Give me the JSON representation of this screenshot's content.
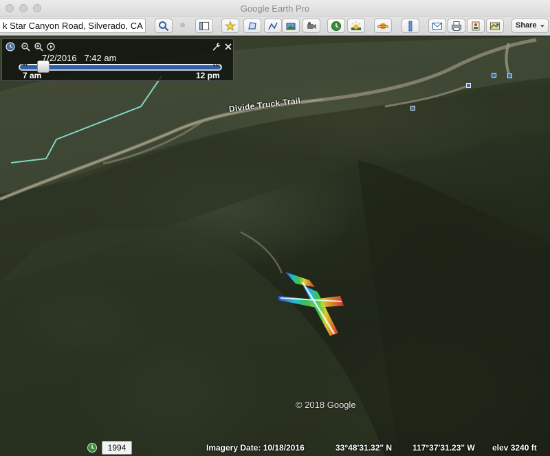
{
  "window": {
    "title": "Google Earth Pro"
  },
  "toolbar": {
    "search_value": "k Star Canyon Road, Silverado, CA",
    "buttons": [
      {
        "name": "search-button",
        "icon": "magnifier-icon"
      },
      {
        "name": "sidebar-toggle-button",
        "icon": "sidebar-icon"
      },
      {
        "name": "add-placemark-button",
        "icon": "pushpin-star-icon"
      },
      {
        "name": "add-polygon-button",
        "icon": "polygon-icon"
      },
      {
        "name": "add-path-button",
        "icon": "path-icon"
      },
      {
        "name": "add-image-overlay-button",
        "icon": "image-overlay-icon"
      },
      {
        "name": "record-tour-button",
        "icon": "record-tour-icon"
      },
      {
        "name": "historical-imagery-button",
        "icon": "clock-globe-icon"
      },
      {
        "name": "sunlight-button",
        "icon": "sun-icon"
      },
      {
        "name": "switch-planet-button",
        "icon": "planet-icon"
      },
      {
        "name": "ruler-button",
        "icon": "ruler-icon"
      },
      {
        "name": "email-button",
        "icon": "email-icon"
      },
      {
        "name": "print-button",
        "icon": "print-icon"
      },
      {
        "name": "save-image-button",
        "icon": "save-image-icon"
      },
      {
        "name": "view-in-maps-button",
        "icon": "map-icon"
      }
    ],
    "share_label": "Share"
  },
  "time_slider": {
    "datetime": "7/2/2016   7:42 am",
    "start_label": "7 am",
    "end_label": "12 pm",
    "position": 0.05
  },
  "map": {
    "trail_label": "Divide Truck Trail",
    "copyright": "© 2018 Google"
  },
  "status_bar": {
    "historical_year": "1994",
    "imagery_date": "Imagery Date: 10/18/2016",
    "latitude": "33°48'31.32\" N",
    "longitude": "117°37'31.23\" W",
    "elevation": "elev  3240 ft"
  },
  "colors": {
    "accent": "#2f5fa6",
    "trail_line": "#7fd9c6"
  }
}
